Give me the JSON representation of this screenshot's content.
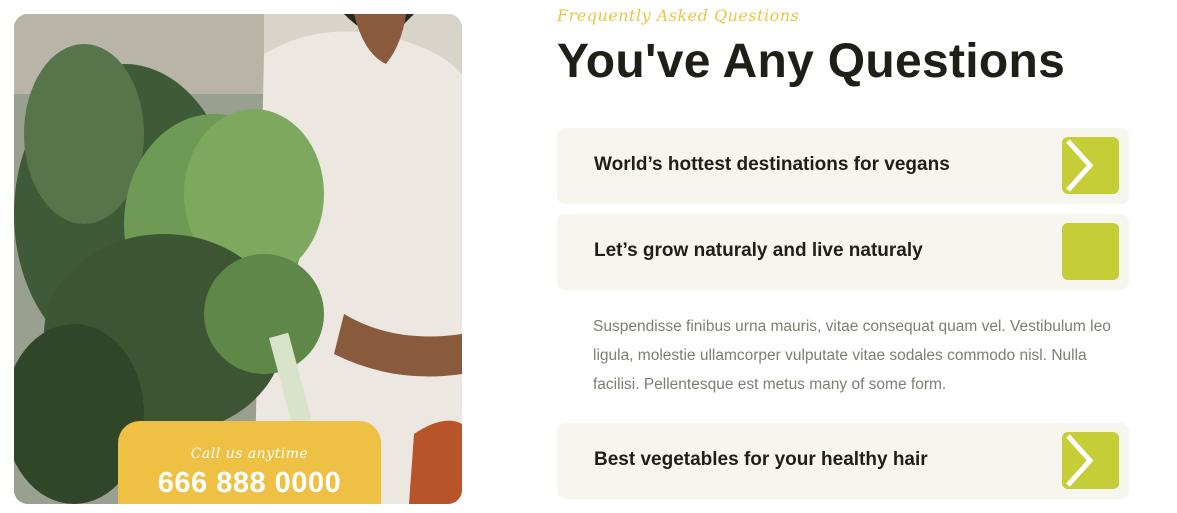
{
  "photo": {
    "icon": "woman-holding-kale-photo"
  },
  "call": {
    "label": "Call us anytime",
    "number": "666 888 0000"
  },
  "faq": {
    "tagline": "Frequently Asked Questions",
    "title": "You've Any Questions",
    "items": [
      {
        "question": "World’s hottest destinations for vegans",
        "expanded": false
      },
      {
        "question": "Let’s grow naturaly and live naturaly",
        "expanded": true,
        "answer": "Suspendisse finibus urna mauris, vitae consequat quam vel. Vestibulum leo ligula, molestie ullamcorper vulputate vitae sodales commodo nisl. Nulla facilisi. Pellentesque est metus many of some form."
      },
      {
        "question": "Best vegetables for your healthy hair",
        "expanded": false
      }
    ]
  },
  "colors": {
    "accent_green": "#c5ce37",
    "accent_yellow": "#eec044",
    "card_bg": "#f6f5ee",
    "heading": "#1f1e17",
    "body_text": "#7d7d74"
  }
}
